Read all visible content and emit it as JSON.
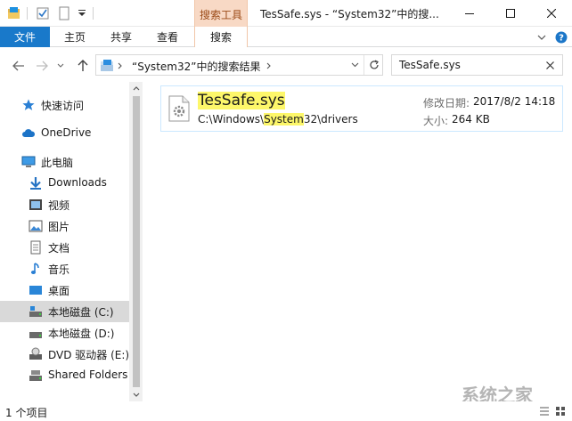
{
  "window": {
    "title": "TesSafe.sys - “System32”中的搜...",
    "contextual_tab": "搜索工具",
    "minimize": "—",
    "maximize": "☐",
    "close": "✕"
  },
  "ribbon": {
    "tabs": [
      "文件",
      "主页",
      "共享",
      "查看",
      "搜索"
    ]
  },
  "address": {
    "path": "“System32”中的搜索结果",
    "search_value": "TesSafe.sys"
  },
  "nav": {
    "items": [
      {
        "label": "快速访问",
        "icon": "star-icon"
      },
      {
        "label": "OneDrive",
        "icon": "cloud-icon"
      },
      {
        "label": "此电脑",
        "icon": "computer-icon"
      },
      {
        "label": "Downloads",
        "icon": "download-icon"
      },
      {
        "label": "视频",
        "icon": "video-icon"
      },
      {
        "label": "图片",
        "icon": "picture-icon"
      },
      {
        "label": "文档",
        "icon": "document-icon"
      },
      {
        "label": "音乐",
        "icon": "music-icon"
      },
      {
        "label": "桌面",
        "icon": "desktop-icon"
      },
      {
        "label": "本地磁盘 (C:)",
        "icon": "drive-c-icon"
      },
      {
        "label": "本地磁盘 (D:)",
        "icon": "drive-d-icon"
      },
      {
        "label": "DVD 驱动器 (E:)",
        "icon": "dvd-icon"
      },
      {
        "label": "Shared Folders",
        "icon": "shared-folder-icon"
      }
    ]
  },
  "result": {
    "name": "TesSafe.sys",
    "path_prefix": "C:\\Windows\\",
    "path_match": "System",
    "path_suffix": "32\\drivers",
    "modified_label": "修改日期:",
    "modified_value": "2017/8/2 14:18",
    "size_label": "大小:",
    "size_value": "264 KB"
  },
  "status": {
    "count": "1 个项目"
  },
  "watermark": "系统之家"
}
